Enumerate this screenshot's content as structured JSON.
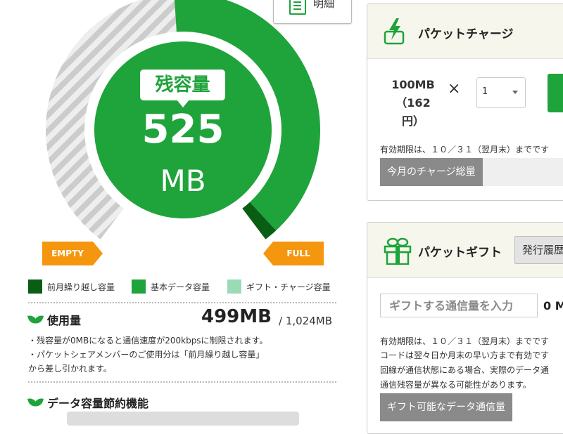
{
  "gauge": {
    "remaining_label": "残容量",
    "remaining_value": "525",
    "remaining_unit": "MB",
    "empty_label": "EMPTY",
    "full_label": "FULL",
    "remaining_fraction": 0.513,
    "carryover_fraction": 0.02,
    "colors": {
      "carryover": "#0a5e14",
      "basic": "#1fa33b",
      "gift": "#99dbb5",
      "used_stripe": "#cccccc",
      "bg_gray": "#eeeeee",
      "center": "#1fa33b",
      "accent_orange": "#f5960f"
    }
  },
  "detail_button": {
    "label": "明細",
    "icon": "document-edit-icon"
  },
  "legend": [
    {
      "label": "前月繰り越し容量",
      "color": "#0a5e14"
    },
    {
      "label": "基本データ容量",
      "color": "#1fa33b"
    },
    {
      "label": "ギフト・チャージ容量",
      "color": "#99dbb5"
    }
  ],
  "usage": {
    "title": "使用量",
    "value": "499MB",
    "total": "/ 1,024MB",
    "notes": [
      "・残容量が0MBになると通信速度が200kbpsに制限されます。",
      "・パケットシェアメンバーのご使用分は「前月繰り越し容量」",
      "から差し引かれます。"
    ]
  },
  "saving": {
    "title": "データ容量節約機能"
  },
  "charge": {
    "title": "パケットチャージ",
    "icon": "charge-bolt-icon",
    "price_amount": "100MB",
    "price_yen": "（162円）",
    "times": "×",
    "quantity": "1",
    "expiry_note": "有効期限は、１０／３１（翌月末）までです",
    "total_label": "今月のチャージ総量"
  },
  "gift": {
    "title": "パケットギフト",
    "icon": "gift-box-icon",
    "history_button": "発行履歴",
    "input_placeholder": "ギフトする通信量を入力",
    "input_unit": "0 M",
    "notes": [
      "有効期限は、１０／３１（翌月末）までです",
      "コードは翌々日か月末の早い方まで有効です",
      "回線が通信状態にある場合、実際のデータ通",
      "通信残容量が異なる可能性があります。"
    ],
    "available_label": "ギフト可能なデータ通信量"
  }
}
